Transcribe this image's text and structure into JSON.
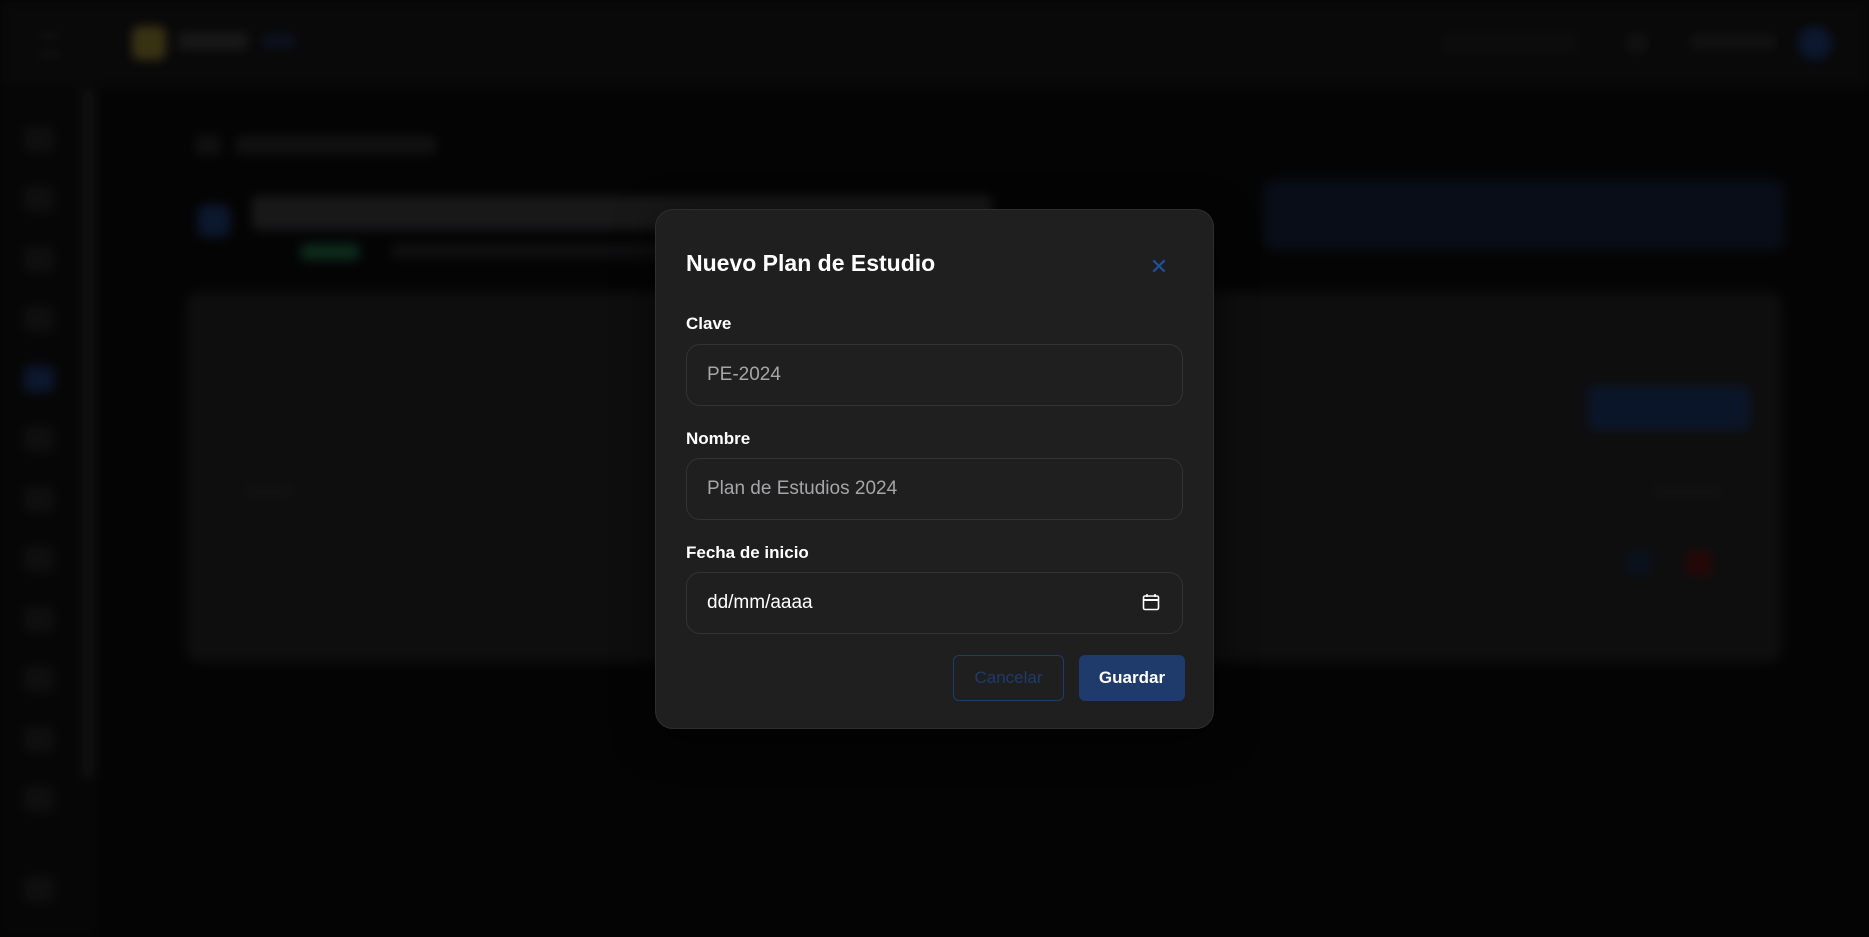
{
  "modal": {
    "title": "Nuevo Plan de Estudio",
    "close_icon": "close-icon",
    "fields": {
      "clave": {
        "label": "Clave",
        "placeholder": "PE-2024"
      },
      "nombre": {
        "label": "Nombre",
        "placeholder": "Plan de Estudios 2024"
      },
      "fecha": {
        "label": "Fecha de inicio",
        "placeholder": "dd/mm/aaaa",
        "icon": "calendar-icon"
      }
    },
    "buttons": {
      "cancel": "Cancelar",
      "save": "Guardar"
    }
  },
  "colors": {
    "accent": "#1f3b6b",
    "modal_bg": "#1f1f20",
    "backdrop": "#0b0b0c"
  }
}
